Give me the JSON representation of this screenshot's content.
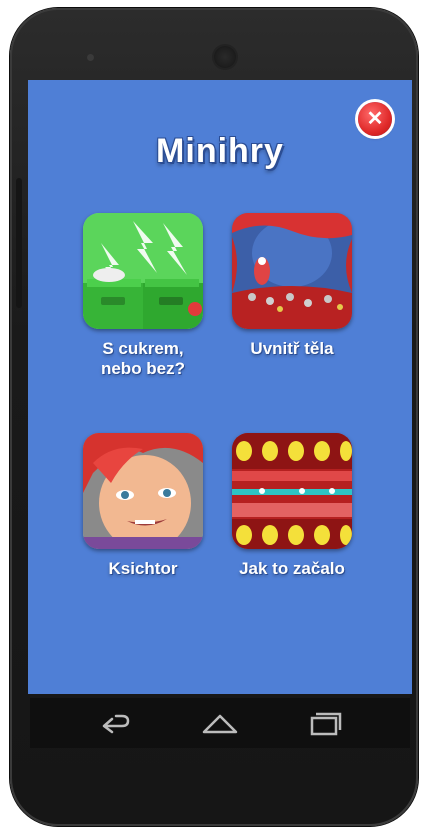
{
  "screen": {
    "title": "Minihry",
    "close_icon": "close-icon",
    "colors": {
      "background": "#4f7fd6",
      "close": "#e02a2a"
    }
  },
  "games": [
    {
      "label": "S cukrem,\nnebo bez?"
    },
    {
      "label": "Uvnitř těla"
    },
    {
      "label": "Ksichtor"
    },
    {
      "label": "Jak to začalo"
    }
  ],
  "navbar": {
    "back_icon": "back-icon",
    "home_icon": "home-icon",
    "recents_icon": "recents-icon"
  }
}
